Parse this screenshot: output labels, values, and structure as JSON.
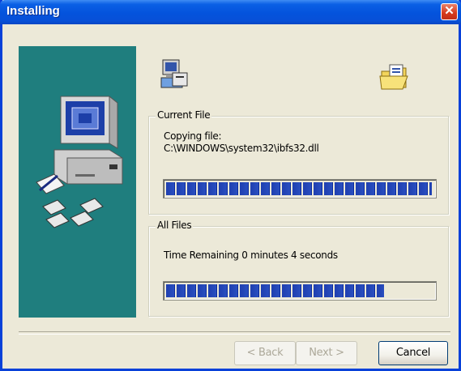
{
  "window": {
    "title": "Installing",
    "close_glyph": "✕",
    "title_color": "#0453dc"
  },
  "current_file": {
    "label": "Current File",
    "line1": "Copying file:",
    "line2": "C:\\WINDOWS\\system32\\ibfs32.dll",
    "progress_percent": 100
  },
  "all_files": {
    "label": "All Files",
    "time_remaining": "Time Remaining 0 minutes 4 seconds",
    "progress_percent": 82
  },
  "buttons": {
    "back": "< Back",
    "next": "Next >",
    "cancel": "Cancel"
  },
  "icons": {
    "install": "install-package-icon",
    "folder": "open-folder-icon",
    "computer": "computer-illustration",
    "progress_color": "#1f3fb0",
    "sidebar_color": "#1f7e7e"
  }
}
